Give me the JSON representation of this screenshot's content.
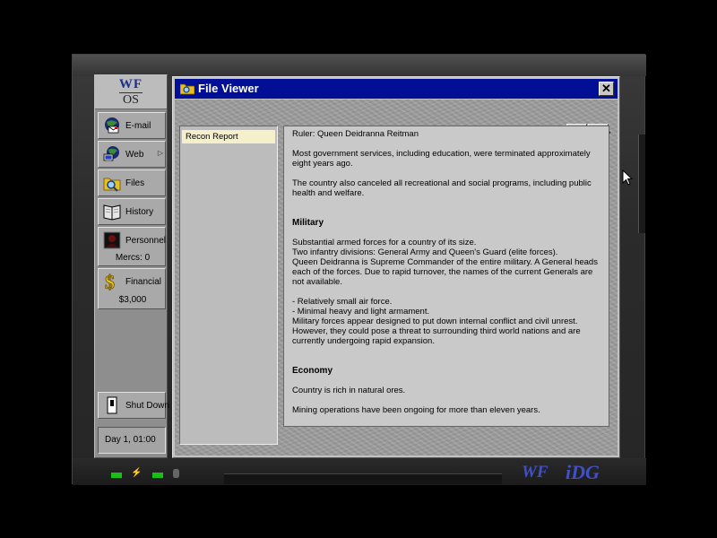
{
  "logo": {
    "line1": "WF",
    "line2": "OS"
  },
  "sidebar": {
    "items": [
      {
        "id": "email",
        "label": "E-mail",
        "icon": "email-icon"
      },
      {
        "id": "web",
        "label": "Web",
        "icon": "web-icon"
      },
      {
        "id": "files",
        "label": "Files",
        "icon": "files-icon"
      },
      {
        "id": "history",
        "label": "History",
        "icon": "book-icon"
      },
      {
        "id": "personnel",
        "label": "Personnel",
        "sub": "Mercs: 0",
        "icon": "personnel-icon"
      },
      {
        "id": "financial",
        "label": "Financial",
        "sub": "$3,000",
        "icon": "dollar-icon"
      }
    ],
    "shutdown_label": "Shut Down",
    "date": "Day 1, 01:00"
  },
  "window": {
    "title": "File Viewer",
    "close_glyph": "✕",
    "prev_glyph": "⟵",
    "next_glyph": "⟶",
    "files": [
      "Recon Report"
    ],
    "content": {
      "ruler": "Ruler: Queen Deidranna Reitman",
      "p1": "Most government services, including education, were terminated approximately eight years ago.",
      "p2": "The country also canceled all recreational and social programs, including public health and welfare.",
      "h_military": "Military",
      "m1": "Substantial armed forces for a country of its size.",
      "m2": "Two infantry divisions: General Army and Queen's Guard (elite forces).",
      "m3": "Queen Deidranna is Supreme Commander of the entire military. A General heads each of the forces. Due to rapid turnover, the names of the current Generals are not available.",
      "m4": "- Relatively small air force.",
      "m5": "- Minimal heavy and light armament.",
      "m6": "Military forces appear designed to put down internal conflict and civil unrest. However, they could pose a threat to surrounding third world nations and are currently undergoing rapid expansion.",
      "h_economy": "Economy",
      "e1": "Country is rich in natural ores.",
      "e2": "Mining operations have been ongoing for more than eleven years."
    }
  },
  "branding": {
    "wf": "WF",
    "idg": "iDG"
  },
  "colors": {
    "titlebar": "#000f96",
    "selected_file": "#f5efcc",
    "led": "#18c018",
    "brand": "#4050c8"
  }
}
